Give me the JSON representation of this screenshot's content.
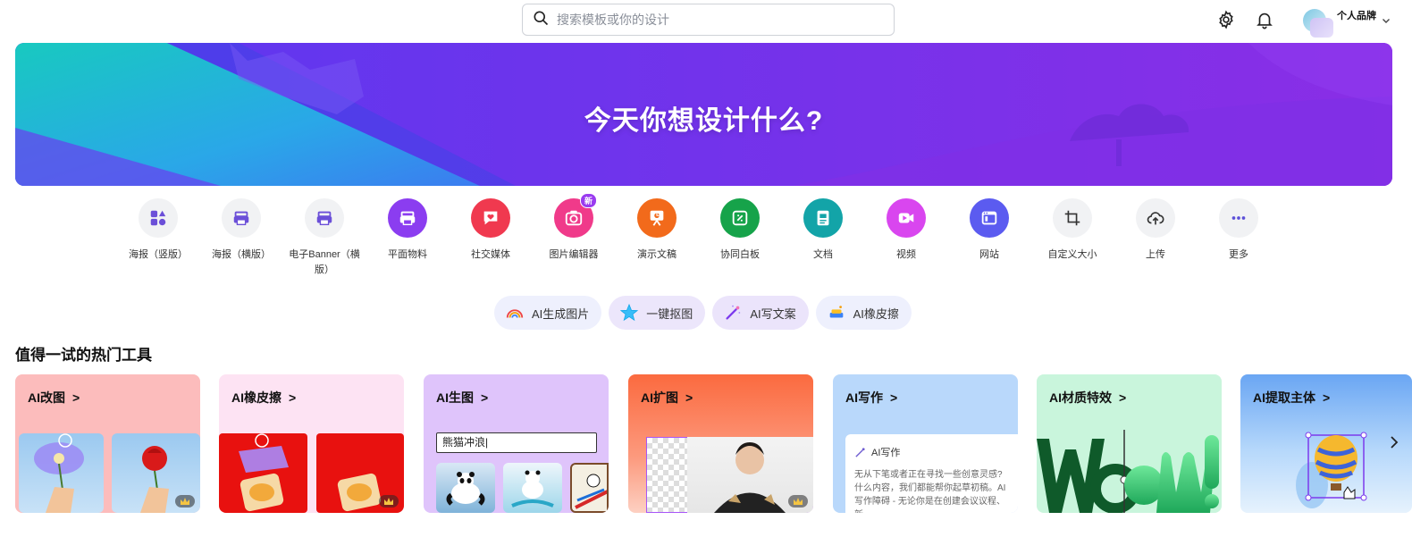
{
  "search": {
    "placeholder": "搜索模板或你的设计"
  },
  "account": {
    "name": "个人品牌"
  },
  "banner": {
    "title": "今天你想设计什么?"
  },
  "categories": [
    {
      "label": "海报（竖版）",
      "icon": "shapes-icon",
      "color": "#f1f2f4",
      "fg": "#6b4fd8"
    },
    {
      "label": "海报（横版）",
      "icon": "printer-icon",
      "color": "#f1f2f4",
      "fg": "#6b4fd8"
    },
    {
      "label": "电子Banner（横版）",
      "icon": "printer-icon",
      "color": "#f1f2f4",
      "fg": "#6b4fd8"
    },
    {
      "label": "平面物料",
      "icon": "printer-icon",
      "color": "#8b3df0",
      "fg": "#ffffff"
    },
    {
      "label": "社交媒体",
      "icon": "heart-chat-icon",
      "color": "#f0394f",
      "fg": "#ffffff"
    },
    {
      "label": "图片编辑器",
      "icon": "camera-icon",
      "color": "#f03a8a",
      "fg": "#ffffff",
      "badge": "新"
    },
    {
      "label": "演示文稿",
      "icon": "presentation-icon",
      "color": "#f26a1b",
      "fg": "#ffffff"
    },
    {
      "label": "协同白板",
      "icon": "whiteboard-icon",
      "color": "#16a34a",
      "fg": "#ffffff"
    },
    {
      "label": "文档",
      "icon": "document-icon",
      "color": "#13a4a8",
      "fg": "#ffffff"
    },
    {
      "label": "视频",
      "icon": "video-icon",
      "color": "#d946ef",
      "fg": "#ffffff"
    },
    {
      "label": "网站",
      "icon": "website-icon",
      "color": "#5b5bf0",
      "fg": "#ffffff"
    },
    {
      "label": "自定义大小",
      "icon": "crop-icon",
      "color": "#f1f2f4",
      "fg": "#333333"
    },
    {
      "label": "上传",
      "icon": "cloud-upload-icon",
      "color": "#f1f2f4",
      "fg": "#333333"
    },
    {
      "label": "更多",
      "icon": "more-icon",
      "color": "#f1f2f4",
      "fg": "#5b4fd8"
    }
  ],
  "ai_pills": [
    {
      "label": "AI生成图片",
      "icon": "rainbow-icon"
    },
    {
      "label": "一键抠图",
      "icon": "star-icon"
    },
    {
      "label": "AI写文案",
      "icon": "magic-wand-icon"
    },
    {
      "label": "AI橡皮擦",
      "icon": "eraser-icon"
    }
  ],
  "section": {
    "title": "值得一试的热门工具"
  },
  "tools": [
    {
      "title": "AI改图",
      "bg": "#fcbcbc"
    },
    {
      "title": "AI橡皮擦",
      "bg": "#fde3f3"
    },
    {
      "title": "AI生图",
      "bg": "#dfc4fb",
      "input_value": "熊猫冲浪"
    },
    {
      "title": "AI扩图",
      "bg": "#fb7a55"
    },
    {
      "title": "AI写作",
      "bg": "#b9d8fb",
      "writer_label": "AI写作",
      "writer_text": "无从下笔或者正在寻找一些创意灵感?什么内容，我们都能帮你起草初稿。AI写作障碍 - 无论你是在创建会议议程、新"
    },
    {
      "title": "AI材质特效",
      "bg": "#c9f5dc"
    },
    {
      "title": "AI提取主体",
      "bg": "#a9d4f8"
    }
  ],
  "colors": {
    "accent": "#6a3cf0",
    "banner_teal": "#12c2c7"
  }
}
